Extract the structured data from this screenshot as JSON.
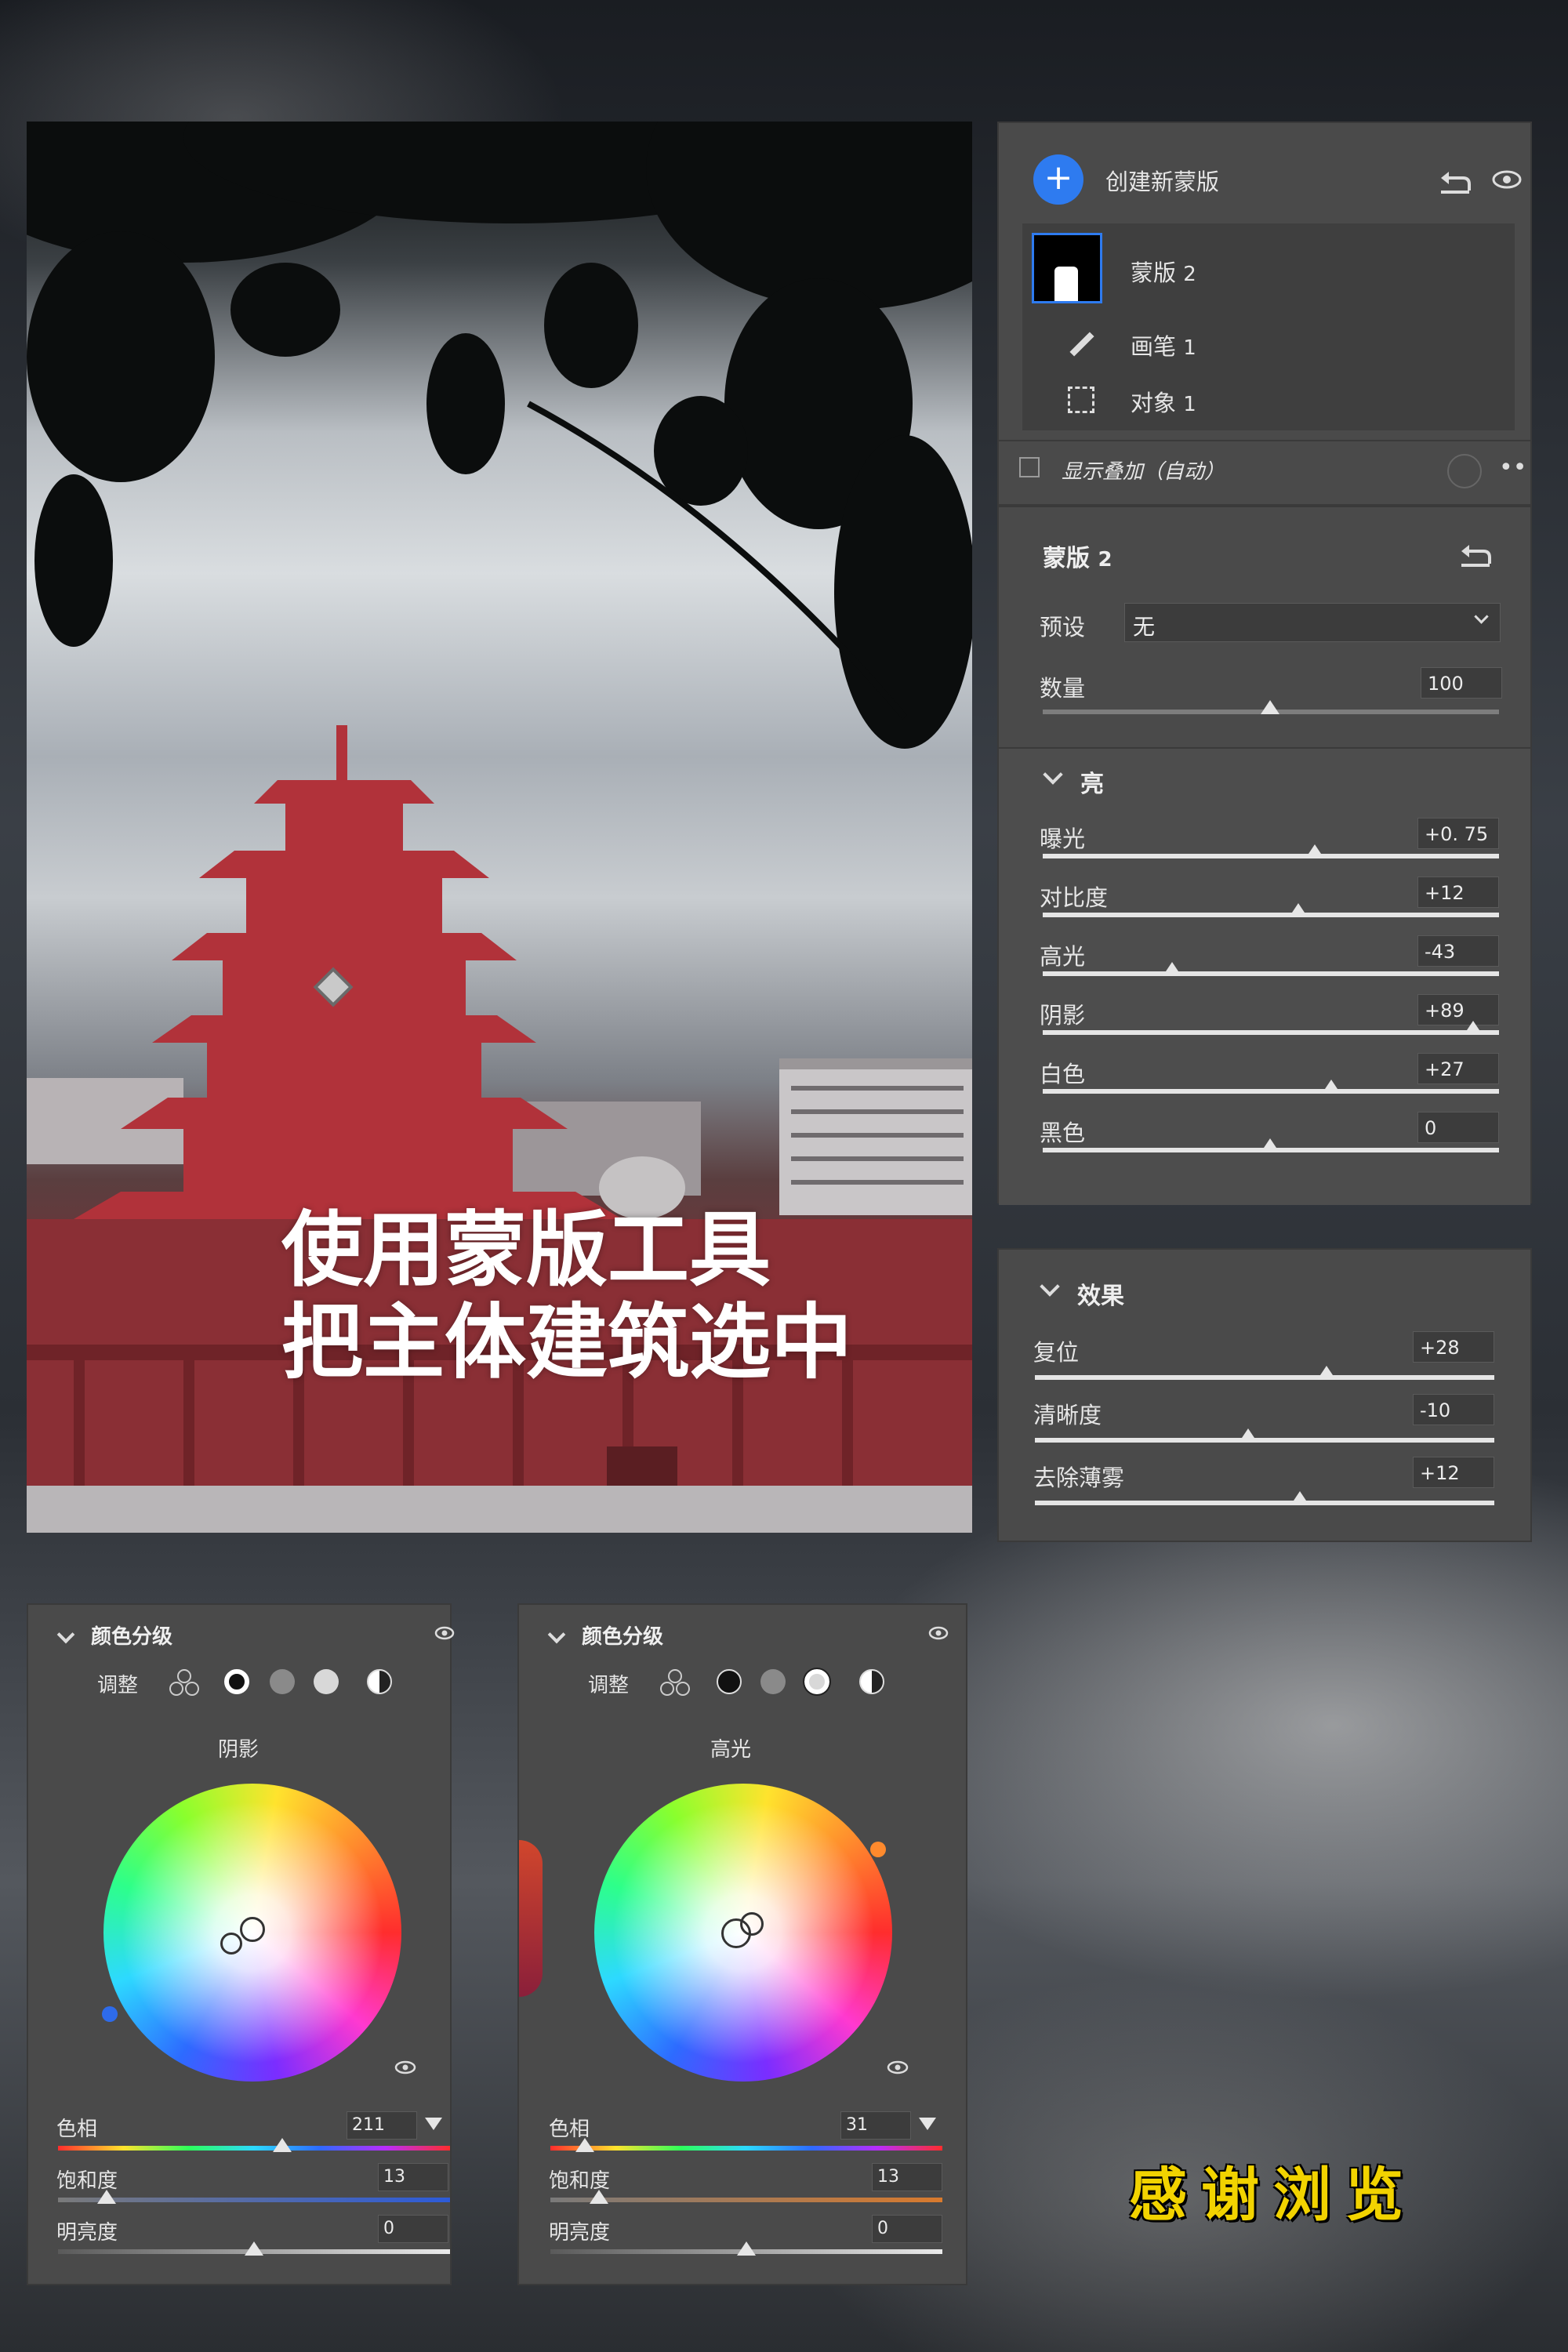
{
  "masks_panel": {
    "create_new_mask": "创建新蒙版",
    "mask_name": "蒙版",
    "mask_number": "2",
    "sub_items": [
      {
        "label": "画笔",
        "count": "1"
      },
      {
        "label": "对象",
        "count": "1"
      }
    ],
    "show_overlay": "显示叠加（自动）"
  },
  "mask_settings": {
    "title": "蒙版",
    "number": "2",
    "preset_label": "预设",
    "preset_value": "无",
    "amount_label": "数量",
    "amount_value": "100"
  },
  "light_section": {
    "title": "亮",
    "sliders": [
      {
        "label": "曝光",
        "value": "+0. 75"
      },
      {
        "label": "对比度",
        "value": "+12"
      },
      {
        "label": "高光",
        "value": "-43"
      },
      {
        "label": "阴影",
        "value": "+89"
      },
      {
        "label": "白色",
        "value": "+27"
      },
      {
        "label": "黑色",
        "value": "0"
      }
    ]
  },
  "effects_section": {
    "title": "效果",
    "sliders": [
      {
        "label": "复位",
        "value": "+28"
      },
      {
        "label": "清晰度",
        "value": "-10"
      },
      {
        "label": "去除薄雾",
        "value": "+12"
      }
    ]
  },
  "caption": {
    "line1": "使用蒙版工具",
    "line2": "把主体建筑选中"
  },
  "color_grading_left": {
    "title": "颜色分级",
    "adjust_label": "调整",
    "wheel_label": "阴影",
    "hue_label": "色相",
    "hue_value": "211",
    "saturation_label": "饱和度",
    "saturation_value": "13",
    "luminance_label": "明亮度",
    "luminance_value": "0"
  },
  "color_grading_right": {
    "title": "颜色分级",
    "adjust_label": "调整",
    "wheel_label": "高光",
    "hue_label": "色相",
    "hue_value": "31",
    "saturation_label": "饱和度",
    "saturation_value": "13",
    "luminance_label": "明亮度",
    "luminance_value": "0"
  },
  "thanks": "感谢浏览",
  "colors": {
    "accent_blue": "#2e7bf0",
    "panel_bg": "#4a4a4a",
    "thanks_yellow": "#f2d300",
    "mask_overlay": "#a32a30"
  }
}
